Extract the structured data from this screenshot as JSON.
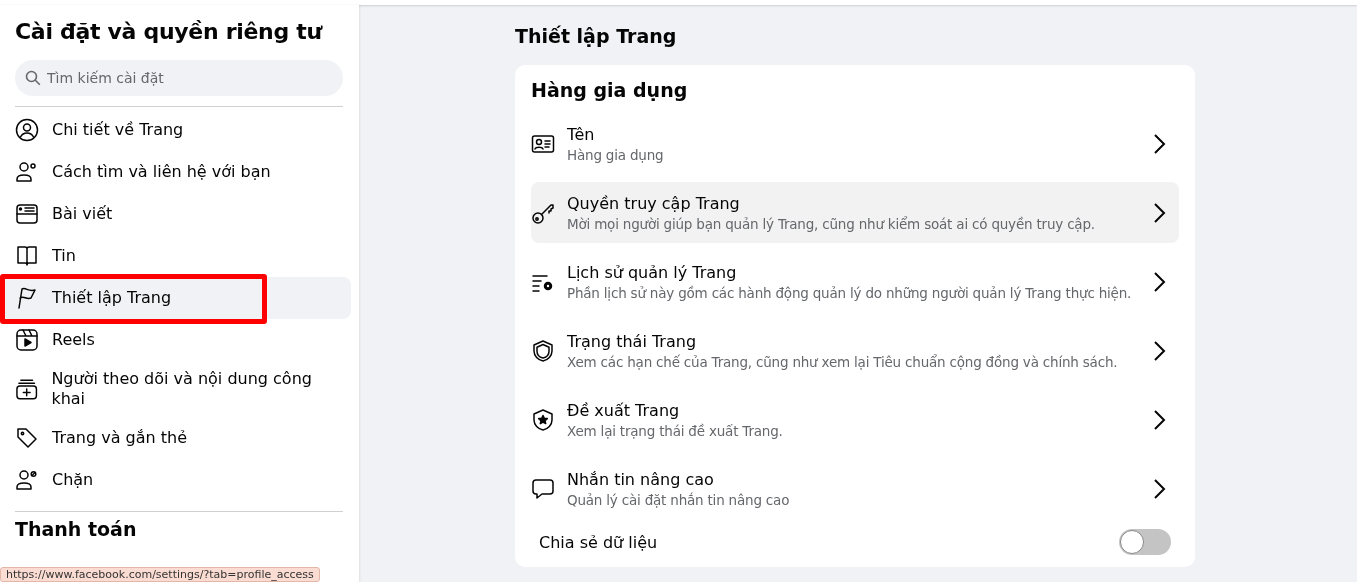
{
  "sidebar": {
    "title": "Cài đặt và quyền riêng tư",
    "search": {
      "placeholder": "Tìm kiếm cài đặt"
    },
    "items": [
      {
        "label": "Chi tiết về Trang",
        "selected": false,
        "outlined": false
      },
      {
        "label": "Cách tìm và liên hệ với bạn",
        "selected": false,
        "outlined": false
      },
      {
        "label": "Bài viết",
        "selected": false,
        "outlined": false
      },
      {
        "label": "Tin",
        "selected": false,
        "outlined": false
      },
      {
        "label": "Thiết lập Trang",
        "selected": true,
        "outlined": true
      },
      {
        "label": "Reels",
        "selected": false,
        "outlined": false
      },
      {
        "label": "Người theo dõi và nội dung công khai",
        "selected": false,
        "outlined": false
      },
      {
        "label": "Trang và gắn thẻ",
        "selected": false,
        "outlined": false
      },
      {
        "label": "Chặn",
        "selected": false,
        "outlined": false
      }
    ],
    "section_title": "Thanh toán"
  },
  "status_url": "https://www.facebook.com/settings/?tab=profile_access",
  "main": {
    "title": "Thiết lập Trang",
    "card": {
      "title": "Hàng gia dụng",
      "rows": [
        {
          "title": "Tên",
          "subtitle": "Hàng gia dụng",
          "hovered": false
        },
        {
          "title": "Quyền truy cập Trang",
          "subtitle": "Mời mọi người giúp bạn quản lý Trang, cũng như kiểm soát ai có quyền truy cập.",
          "hovered": true
        },
        {
          "title": "Lịch sử quản lý Trang",
          "subtitle": "Phần lịch sử này gồm các hành động quản lý do những người quản lý Trang thực hiện.",
          "hovered": false
        },
        {
          "title": "Trạng thái Trang",
          "subtitle": "Xem các hạn chế của Trang, cũng như xem lại Tiêu chuẩn cộng đồng và chính sách.",
          "hovered": false
        },
        {
          "title": "Đề xuất Trang",
          "subtitle": "Xem lại trạng thái đề xuất Trang.",
          "hovered": false
        },
        {
          "title": "Nhắn tin nâng cao",
          "subtitle": "Quản lý cài đặt nhắn tin nâng cao",
          "hovered": false
        }
      ],
      "toggle": {
        "label": "Chia sẻ dữ liệu",
        "on": false
      }
    }
  }
}
